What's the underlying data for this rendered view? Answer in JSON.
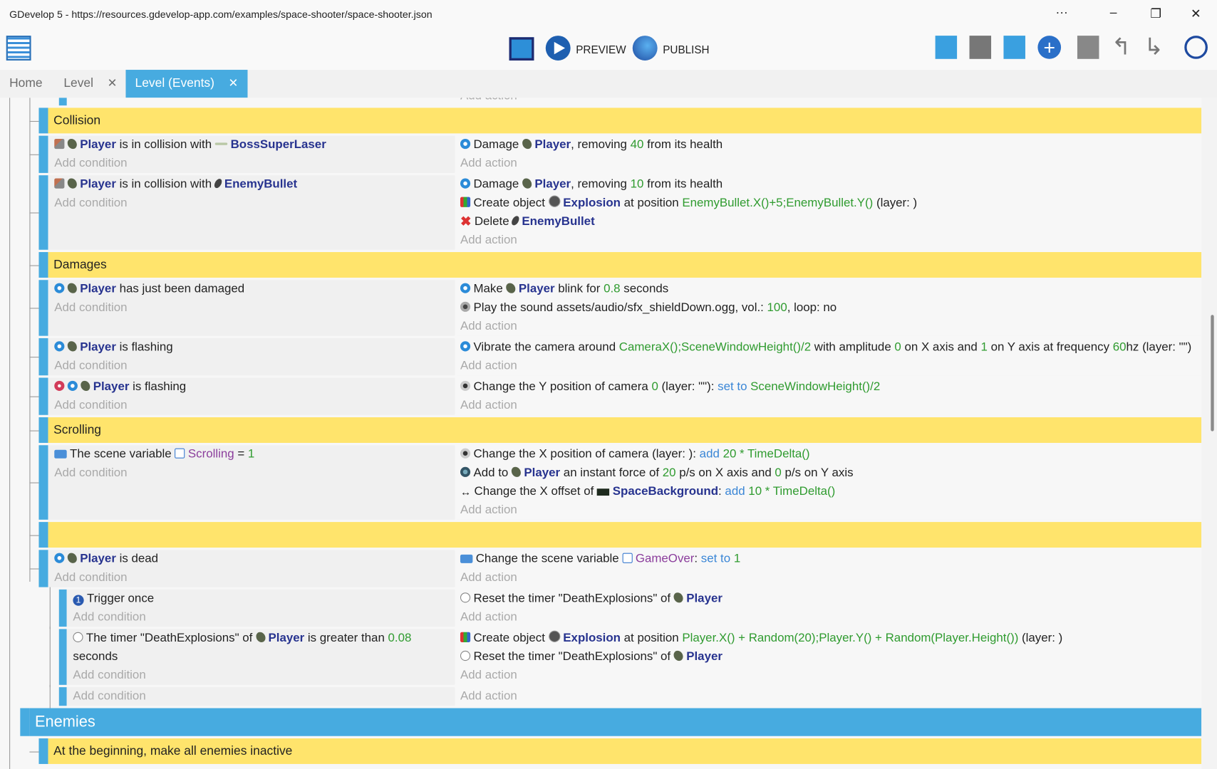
{
  "window": {
    "title": "GDevelop 5 - https://resources.gdevelop-app.com/examples/space-shooter/space-shooter.json",
    "more": "···",
    "minimize": "–",
    "restore": "❐",
    "close": "✕"
  },
  "toolbar": {
    "preview_label": "PREVIEW",
    "publish_label": "PUBLISH"
  },
  "tabs": [
    {
      "label": "Home",
      "active": false,
      "closable": false
    },
    {
      "label": "Level",
      "active": false,
      "closable": true
    },
    {
      "label": "Level (Events)",
      "active": true,
      "closable": true
    }
  ],
  "tab_close": "✕",
  "colors": {
    "accent": "#47abe0",
    "group": "#ffe46c",
    "object": "#27338f",
    "value": "#2f9b2f",
    "keyword": "#3a86d6",
    "variable": "#8b3d9c"
  },
  "add_condition": "Add condition",
  "add_action": "Add action",
  "events": [
    {
      "kind": "event",
      "depth": 1,
      "partial": true,
      "conditions": [],
      "actions": []
    },
    {
      "kind": "group",
      "depth": 1,
      "title": "Collision"
    },
    {
      "kind": "event",
      "depth": 1,
      "conditions": [
        [
          [
            "i",
            "collision-icon"
          ],
          [
            "i",
            "player-icon"
          ],
          [
            "o",
            "Player"
          ],
          [
            "t",
            " is in collision with "
          ],
          [
            "i",
            "laser-icon"
          ],
          [
            "o",
            "BossSuperLaser"
          ]
        ]
      ],
      "actions": [
        [
          [
            "i",
            "gear-icon"
          ],
          [
            "t",
            "Damage "
          ],
          [
            "i",
            "player-icon"
          ],
          [
            "o",
            "Player"
          ],
          [
            "t",
            ", removing "
          ],
          [
            "n",
            "40"
          ],
          [
            "t",
            " from its health"
          ]
        ]
      ]
    },
    {
      "kind": "event",
      "depth": 1,
      "conditions": [
        [
          [
            "i",
            "collision-icon"
          ],
          [
            "i",
            "player-icon"
          ],
          [
            "o",
            "Player"
          ],
          [
            "t",
            " is in collision with "
          ],
          [
            "i",
            "bullet-icon"
          ],
          [
            "o",
            "EnemyBullet"
          ]
        ]
      ],
      "actions": [
        [
          [
            "i",
            "gear-icon"
          ],
          [
            "t",
            "Damage "
          ],
          [
            "i",
            "player-icon"
          ],
          [
            "o",
            "Player"
          ],
          [
            "t",
            ", removing "
          ],
          [
            "n",
            "10"
          ],
          [
            "t",
            " from its health"
          ]
        ],
        [
          [
            "i",
            "create-icon"
          ],
          [
            "t",
            "Create object "
          ],
          [
            "i",
            "explosion-icon"
          ],
          [
            "o",
            "Explosion"
          ],
          [
            "t",
            " at position "
          ],
          [
            "n",
            "EnemyBullet.X()+5;EnemyBullet.Y()"
          ],
          [
            "t",
            " (layer: )"
          ]
        ],
        [
          [
            "i",
            "delete-icon"
          ],
          [
            "t",
            "Delete "
          ],
          [
            "i",
            "bullet-icon"
          ],
          [
            "o",
            "EnemyBullet"
          ]
        ]
      ]
    },
    {
      "kind": "group",
      "depth": 1,
      "title": "Damages"
    },
    {
      "kind": "event",
      "depth": 1,
      "conditions": [
        [
          [
            "i",
            "gear-icon"
          ],
          [
            "i",
            "player-icon"
          ],
          [
            "o",
            "Player"
          ],
          [
            "t",
            " has just been damaged"
          ]
        ]
      ],
      "actions": [
        [
          [
            "i",
            "gear-icon"
          ],
          [
            "t",
            "Make "
          ],
          [
            "i",
            "player-icon"
          ],
          [
            "o",
            "Player"
          ],
          [
            "t",
            " blink for "
          ],
          [
            "n",
            "0.8"
          ],
          [
            "t",
            " seconds"
          ]
        ],
        [
          [
            "i",
            "sound-icon"
          ],
          [
            "t",
            "Play the sound "
          ],
          [
            "t",
            "assets/audio/sfx_shieldDown.ogg"
          ],
          [
            "t",
            ", vol.: "
          ],
          [
            "n",
            "100"
          ],
          [
            "t",
            ", loop: "
          ],
          [
            "t",
            "no"
          ]
        ]
      ]
    },
    {
      "kind": "event",
      "depth": 1,
      "conditions": [
        [
          [
            "i",
            "gear-icon"
          ],
          [
            "i",
            "player-icon"
          ],
          [
            "o",
            "Player"
          ],
          [
            "t",
            " is flashing"
          ]
        ]
      ],
      "actions": [
        [
          [
            "i",
            "gear-icon"
          ],
          [
            "t",
            "Vibrate the camera around "
          ],
          [
            "n",
            "CameraX();SceneWindowHeight()/2"
          ],
          [
            "t",
            " with amplitude "
          ],
          [
            "n",
            "0"
          ],
          [
            "t",
            " on X axis and "
          ],
          [
            "n",
            "1"
          ],
          [
            "t",
            " on Y axis at frequency "
          ],
          [
            "n",
            "60"
          ],
          [
            "t",
            "hz (layer: \"\")"
          ]
        ]
      ]
    },
    {
      "kind": "event",
      "depth": 1,
      "conditions": [
        [
          [
            "i",
            "flash-icon"
          ],
          [
            "i",
            "gear-icon"
          ],
          [
            "i",
            "player-icon"
          ],
          [
            "o",
            "Player"
          ],
          [
            "t",
            " is flashing"
          ]
        ]
      ],
      "actions": [
        [
          [
            "i",
            "camera-icon"
          ],
          [
            "t",
            "Change the Y position of camera "
          ],
          [
            "n",
            "0"
          ],
          [
            "t",
            " (layer: \"\"): "
          ],
          [
            "k",
            "set to"
          ],
          [
            "t",
            " "
          ],
          [
            "n",
            "SceneWindowHeight()/2"
          ]
        ]
      ]
    },
    {
      "kind": "group",
      "depth": 1,
      "title": "Scrolling"
    },
    {
      "kind": "event",
      "depth": 1,
      "conditions": [
        [
          [
            "i",
            "variable-icon"
          ],
          [
            "t",
            "The scene variable "
          ],
          [
            "i",
            "varref-icon"
          ],
          [
            "v",
            "Scrolling"
          ],
          [
            "t",
            "  =  "
          ],
          [
            "n",
            "1"
          ]
        ]
      ],
      "actions": [
        [
          [
            "i",
            "camera-icon"
          ],
          [
            "t",
            "Change the X position of camera  (layer: ): "
          ],
          [
            "k",
            "add"
          ],
          [
            "t",
            " "
          ],
          [
            "n",
            "20 * TimeDelta()"
          ]
        ],
        [
          [
            "i",
            "force-icon"
          ],
          [
            "t",
            "Add to "
          ],
          [
            "i",
            "player-icon"
          ],
          [
            "o",
            "Player"
          ],
          [
            "t",
            " an instant force of "
          ],
          [
            "n",
            "20"
          ],
          [
            "t",
            " p/s on X axis and "
          ],
          [
            "n",
            "0"
          ],
          [
            "t",
            " p/s on Y axis"
          ]
        ],
        [
          [
            "i",
            "offset-icon"
          ],
          [
            "t",
            "Change the X offset of "
          ],
          [
            "i",
            "bg-icon"
          ],
          [
            "o",
            "SpaceBackground"
          ],
          [
            "t",
            ": "
          ],
          [
            "k",
            "add"
          ],
          [
            "t",
            " "
          ],
          [
            "n",
            "10 * TimeDelta()"
          ]
        ]
      ]
    },
    {
      "kind": "group",
      "depth": 1,
      "title": ""
    },
    {
      "kind": "event",
      "depth": 1,
      "conditions": [
        [
          [
            "i",
            "gear-icon"
          ],
          [
            "i",
            "player-icon"
          ],
          [
            "o",
            "Player"
          ],
          [
            "t",
            " is dead"
          ]
        ]
      ],
      "actions": [
        [
          [
            "i",
            "variable-icon"
          ],
          [
            "t",
            "Change the scene variable "
          ],
          [
            "i",
            "varref-icon"
          ],
          [
            "v",
            "GameOver"
          ],
          [
            "t",
            ": "
          ],
          [
            "k",
            "set to"
          ],
          [
            "t",
            " "
          ],
          [
            "n",
            "1"
          ]
        ]
      ]
    },
    {
      "kind": "event",
      "depth": 2,
      "conditions": [
        [
          [
            "i",
            "trigger-icon"
          ],
          [
            "t",
            "Trigger once"
          ]
        ]
      ],
      "actions": [
        [
          [
            "i",
            "timer-icon"
          ],
          [
            "t",
            "Reset the timer \"DeathExplosions\" of "
          ],
          [
            "i",
            "player-icon"
          ],
          [
            "o",
            "Player"
          ]
        ]
      ]
    },
    {
      "kind": "event",
      "depth": 2,
      "conditions": [
        [
          [
            "i",
            "timer-icon"
          ],
          [
            "t",
            "The timer \"DeathExplosions\" of "
          ],
          [
            "i",
            "player-icon"
          ],
          [
            "o",
            "Player"
          ],
          [
            "t",
            " is greater than "
          ],
          [
            "n",
            "0.08"
          ],
          [
            "t",
            " seconds"
          ]
        ]
      ],
      "actions": [
        [
          [
            "i",
            "create-icon"
          ],
          [
            "t",
            "Create object "
          ],
          [
            "i",
            "explosion-icon"
          ],
          [
            "o",
            "Explosion"
          ],
          [
            "t",
            " at position "
          ],
          [
            "n",
            "Player.X() + Random(20);Player.Y() + Random(Player.Height())"
          ],
          [
            "t",
            " (layer: )"
          ]
        ],
        [
          [
            "i",
            "timer-icon"
          ],
          [
            "t",
            "Reset the timer \"DeathExplosions\" of "
          ],
          [
            "i",
            "player-icon"
          ],
          [
            "o",
            "Player"
          ]
        ]
      ]
    },
    {
      "kind": "event",
      "depth": 2,
      "conditions": [],
      "actions": []
    },
    {
      "kind": "biggroup",
      "depth": 0,
      "title": "Enemies"
    },
    {
      "kind": "group",
      "depth": 1,
      "title": "At the beginning, make all enemies inactive"
    }
  ]
}
